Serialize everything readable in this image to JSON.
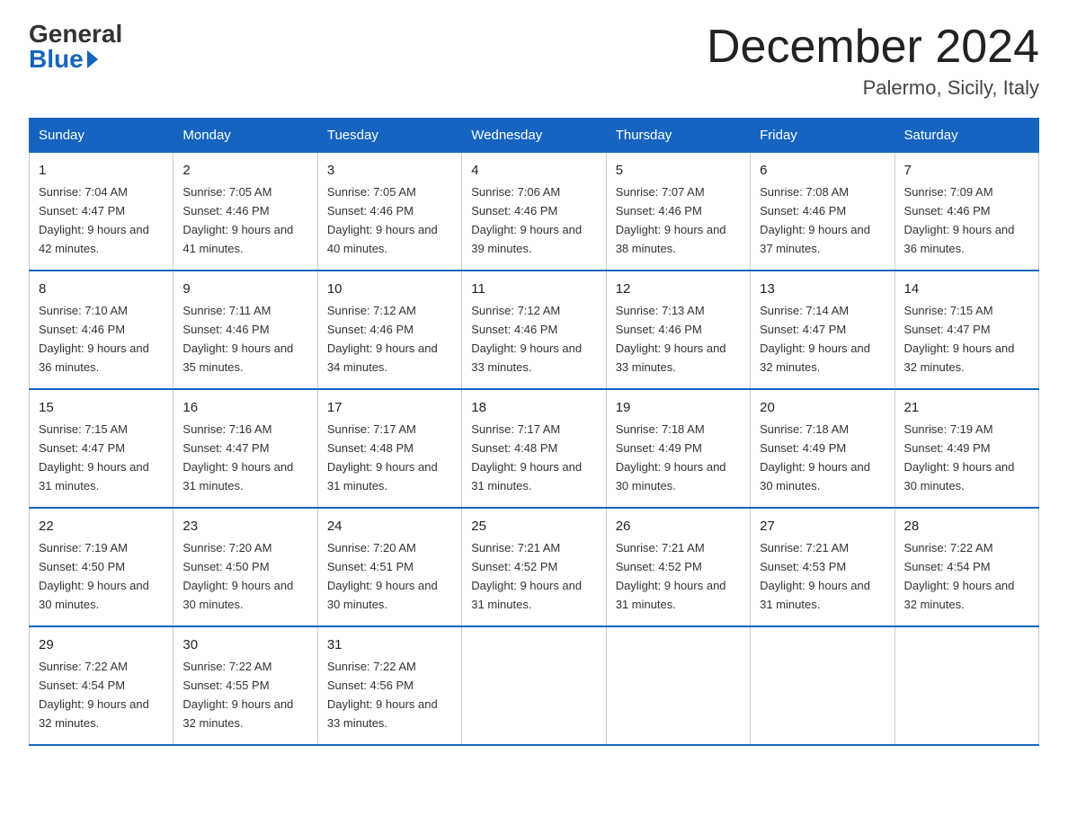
{
  "logo": {
    "general": "General",
    "blue": "Blue"
  },
  "header": {
    "month_year": "December 2024",
    "location": "Palermo, Sicily, Italy"
  },
  "days_of_week": [
    "Sunday",
    "Monday",
    "Tuesday",
    "Wednesday",
    "Thursday",
    "Friday",
    "Saturday"
  ],
  "weeks": [
    [
      {
        "day": "1",
        "sunrise": "7:04 AM",
        "sunset": "4:47 PM",
        "daylight": "9 hours and 42 minutes."
      },
      {
        "day": "2",
        "sunrise": "7:05 AM",
        "sunset": "4:46 PM",
        "daylight": "9 hours and 41 minutes."
      },
      {
        "day": "3",
        "sunrise": "7:05 AM",
        "sunset": "4:46 PM",
        "daylight": "9 hours and 40 minutes."
      },
      {
        "day": "4",
        "sunrise": "7:06 AM",
        "sunset": "4:46 PM",
        "daylight": "9 hours and 39 minutes."
      },
      {
        "day": "5",
        "sunrise": "7:07 AM",
        "sunset": "4:46 PM",
        "daylight": "9 hours and 38 minutes."
      },
      {
        "day": "6",
        "sunrise": "7:08 AM",
        "sunset": "4:46 PM",
        "daylight": "9 hours and 37 minutes."
      },
      {
        "day": "7",
        "sunrise": "7:09 AM",
        "sunset": "4:46 PM",
        "daylight": "9 hours and 36 minutes."
      }
    ],
    [
      {
        "day": "8",
        "sunrise": "7:10 AM",
        "sunset": "4:46 PM",
        "daylight": "9 hours and 36 minutes."
      },
      {
        "day": "9",
        "sunrise": "7:11 AM",
        "sunset": "4:46 PM",
        "daylight": "9 hours and 35 minutes."
      },
      {
        "day": "10",
        "sunrise": "7:12 AM",
        "sunset": "4:46 PM",
        "daylight": "9 hours and 34 minutes."
      },
      {
        "day": "11",
        "sunrise": "7:12 AM",
        "sunset": "4:46 PM",
        "daylight": "9 hours and 33 minutes."
      },
      {
        "day": "12",
        "sunrise": "7:13 AM",
        "sunset": "4:46 PM",
        "daylight": "9 hours and 33 minutes."
      },
      {
        "day": "13",
        "sunrise": "7:14 AM",
        "sunset": "4:47 PM",
        "daylight": "9 hours and 32 minutes."
      },
      {
        "day": "14",
        "sunrise": "7:15 AM",
        "sunset": "4:47 PM",
        "daylight": "9 hours and 32 minutes."
      }
    ],
    [
      {
        "day": "15",
        "sunrise": "7:15 AM",
        "sunset": "4:47 PM",
        "daylight": "9 hours and 31 minutes."
      },
      {
        "day": "16",
        "sunrise": "7:16 AM",
        "sunset": "4:47 PM",
        "daylight": "9 hours and 31 minutes."
      },
      {
        "day": "17",
        "sunrise": "7:17 AM",
        "sunset": "4:48 PM",
        "daylight": "9 hours and 31 minutes."
      },
      {
        "day": "18",
        "sunrise": "7:17 AM",
        "sunset": "4:48 PM",
        "daylight": "9 hours and 31 minutes."
      },
      {
        "day": "19",
        "sunrise": "7:18 AM",
        "sunset": "4:49 PM",
        "daylight": "9 hours and 30 minutes."
      },
      {
        "day": "20",
        "sunrise": "7:18 AM",
        "sunset": "4:49 PM",
        "daylight": "9 hours and 30 minutes."
      },
      {
        "day": "21",
        "sunrise": "7:19 AM",
        "sunset": "4:49 PM",
        "daylight": "9 hours and 30 minutes."
      }
    ],
    [
      {
        "day": "22",
        "sunrise": "7:19 AM",
        "sunset": "4:50 PM",
        "daylight": "9 hours and 30 minutes."
      },
      {
        "day": "23",
        "sunrise": "7:20 AM",
        "sunset": "4:50 PM",
        "daylight": "9 hours and 30 minutes."
      },
      {
        "day": "24",
        "sunrise": "7:20 AM",
        "sunset": "4:51 PM",
        "daylight": "9 hours and 30 minutes."
      },
      {
        "day": "25",
        "sunrise": "7:21 AM",
        "sunset": "4:52 PM",
        "daylight": "9 hours and 31 minutes."
      },
      {
        "day": "26",
        "sunrise": "7:21 AM",
        "sunset": "4:52 PM",
        "daylight": "9 hours and 31 minutes."
      },
      {
        "day": "27",
        "sunrise": "7:21 AM",
        "sunset": "4:53 PM",
        "daylight": "9 hours and 31 minutes."
      },
      {
        "day": "28",
        "sunrise": "7:22 AM",
        "sunset": "4:54 PM",
        "daylight": "9 hours and 32 minutes."
      }
    ],
    [
      {
        "day": "29",
        "sunrise": "7:22 AM",
        "sunset": "4:54 PM",
        "daylight": "9 hours and 32 minutes."
      },
      {
        "day": "30",
        "sunrise": "7:22 AM",
        "sunset": "4:55 PM",
        "daylight": "9 hours and 32 minutes."
      },
      {
        "day": "31",
        "sunrise": "7:22 AM",
        "sunset": "4:56 PM",
        "daylight": "9 hours and 33 minutes."
      },
      null,
      null,
      null,
      null
    ]
  ]
}
